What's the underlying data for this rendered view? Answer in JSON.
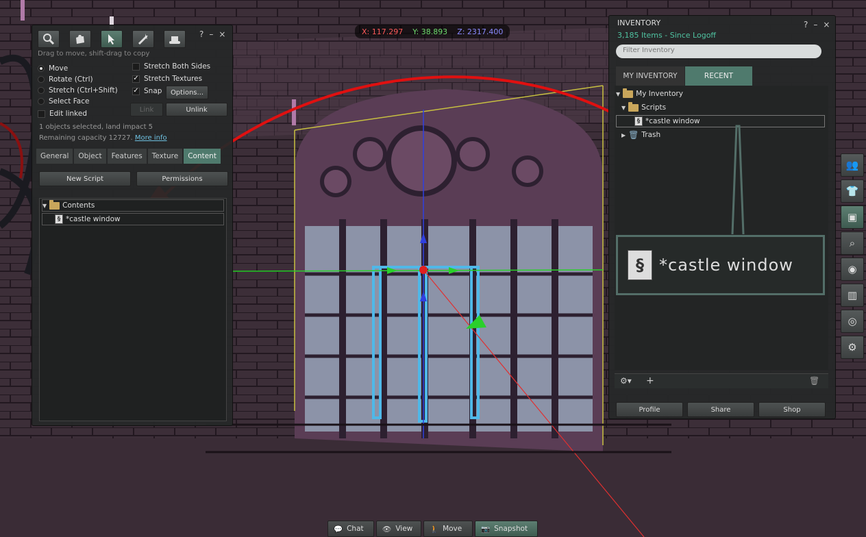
{
  "colors": {
    "accent": "#4f7a6d",
    "item_count": "#4fc3a1",
    "coord_x": "#ff5a5a",
    "coord_y": "#6fdc6f",
    "coord_z": "#8a8aff",
    "arrow": "#e01010",
    "zoom_border": "#536e68"
  },
  "coords": {
    "x": "X: 117.297",
    "y": "Y: 38.893",
    "z": "Z: 2317.400"
  },
  "build": {
    "tool_icons": [
      "focus-icon",
      "grab-hand-icon",
      "pointer-edit-icon",
      "create-wand-icon",
      "land-bulldozer-icon"
    ],
    "active_tool": 2,
    "header_icons": [
      "?",
      "–",
      "×"
    ],
    "hint": "Drag to move, shift-drag to copy",
    "modes": [
      "Move",
      "Rotate (Ctrl)",
      "Stretch (Ctrl+Shift)",
      "Select Face"
    ],
    "selected_mode": "Move",
    "edit_linked": "Edit linked",
    "stretch_both": "Stretch Both Sides",
    "stretch_textures": "Stretch Textures",
    "snap": "Snap",
    "options_btn": "Options...",
    "link_btn": "Link",
    "unlink_btn": "Unlink",
    "selected_info": "1 objects selected, land impact 5",
    "capacity": "Remaining capacity 12727.",
    "more_info": "More info",
    "tabs": [
      "General",
      "Object",
      "Features",
      "Texture",
      "Content"
    ],
    "active_tab": "Content",
    "new_script_btn": "New Script",
    "permissions_btn": "Permissions",
    "contents_folder": "Contents",
    "contents_item": "*castle window"
  },
  "inventory": {
    "title": "INVENTORY",
    "header_icons": [
      "?",
      "–",
      "×"
    ],
    "count": "3,185 Items",
    "since": "- Since Logoff",
    "filter_placeholder": "Filter Inventory",
    "tabs": [
      "MY INVENTORY",
      "RECENT"
    ],
    "active_tab": "RECENT",
    "root": "My Inventory",
    "scripts_folder": "Scripts",
    "script_item": "*castle window",
    "trash": "Trash",
    "zoom_label": "*castle window",
    "footer_buttons": [
      "Profile",
      "Share",
      "Shop"
    ]
  },
  "sidebar": [
    "people-icon",
    "appearance-shirt-icon",
    "inventory-icon",
    "search-icon",
    "places-icon",
    "map-icon",
    "radar-icon",
    "settings-icon"
  ],
  "bottom": {
    "chat": "Chat",
    "view": "View",
    "move": "Move",
    "snapshot": "Snapshot"
  }
}
